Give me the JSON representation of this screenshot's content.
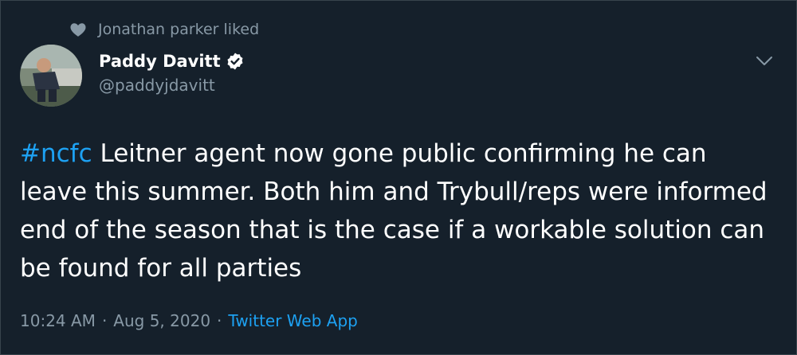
{
  "social_context": {
    "icon": "heart-icon",
    "text": "Jonathan parker liked"
  },
  "author": {
    "display_name": "Paddy Davitt",
    "handle": "@paddyjdavitt",
    "verified_icon": "verified-badge-icon"
  },
  "tweet": {
    "hashtag": "#ncfc",
    "body": " Leitner agent now gone public confirming he can leave this summer. Both him and Trybull/reps were informed end of the season that is the case if a workable solution can be found for all parties"
  },
  "meta": {
    "time": "10:24 AM",
    "separator": "·",
    "date": "Aug 5, 2020",
    "source": "Twitter Web App"
  },
  "colors": {
    "background": "#15202b",
    "text": "#ffffff",
    "secondary": "#8899a6",
    "accent": "#1da1f2"
  }
}
